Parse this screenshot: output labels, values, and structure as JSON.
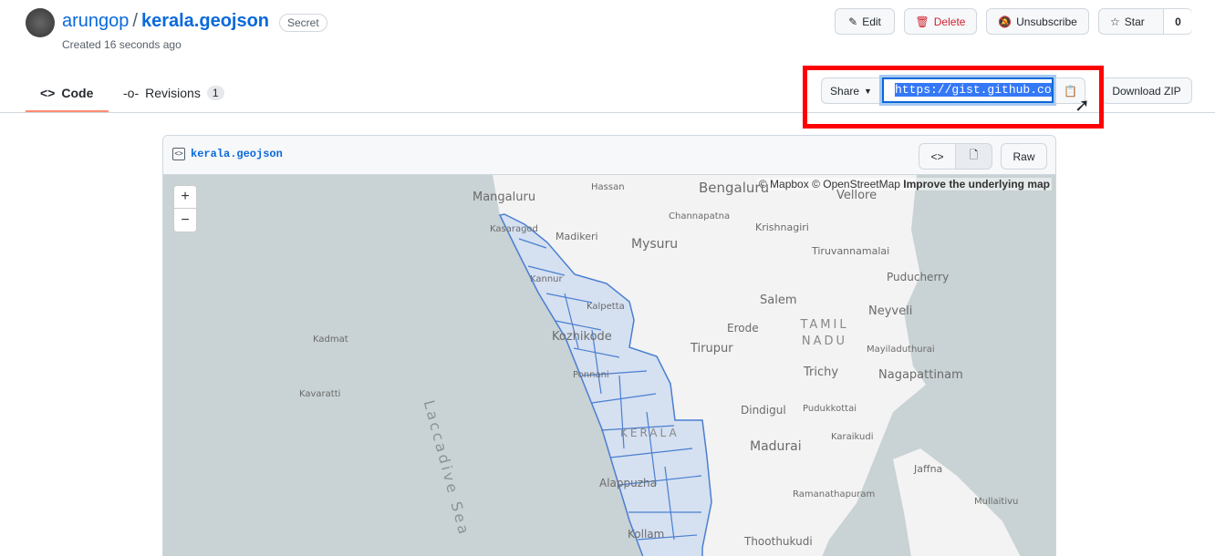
{
  "header": {
    "owner": "arungop",
    "separator": "/",
    "gist_name": "kerala.geojson",
    "visibility": "Secret",
    "created": "Created 16 seconds ago"
  },
  "actions": {
    "edit": "Edit",
    "delete": "Delete",
    "unsubscribe": "Unsubscribe",
    "star": "Star",
    "star_count": "0"
  },
  "tabs": [
    {
      "label": "Code"
    },
    {
      "label": "Revisions",
      "count": "1"
    }
  ],
  "share": {
    "label": "Share",
    "url": "https://gist.github.com",
    "download": "Download ZIP"
  },
  "file": {
    "name": "kerala.geojson",
    "raw": "Raw"
  },
  "map": {
    "attribution_mapbox": "© Mapbox",
    "attribution_osm": "© OpenStreetMap",
    "improve": "Improve the underlying map",
    "zoom_in": "+",
    "zoom_out": "−",
    "labels": [
      "Mangaluru",
      "Hassan",
      "Bengaluru",
      "Vellore",
      "Kasaragod",
      "Madikeri",
      "Channapatna",
      "Krishnagiri",
      "Mysuru",
      "Tiruvannamalai",
      "Puducherry",
      "Kannur",
      "Salem",
      "Kalpetta",
      "Kozhikode",
      "Neyveli",
      "Erode",
      "TAMIL NADU",
      "Kadmat",
      "Tirupur",
      "Mayiladuthurai",
      "Trichy",
      "Nagapattinam",
      "Kavaratti",
      "Ponnani",
      "Dindigul",
      "Pudukkottai",
      "KERALA",
      "Karaikudi",
      "Madurai",
      "Jaffna",
      "Alappuzha",
      "Ramanathapuram",
      "Mullaitivu",
      "Laccadive Sea",
      "Kollam",
      "Thoothukudi"
    ],
    "colors": {
      "sea": "#c9d2d4",
      "land": "#f3f3f3",
      "kerala_fill": "#cfdcf0",
      "kerala_stroke": "#4a7fd0"
    }
  }
}
